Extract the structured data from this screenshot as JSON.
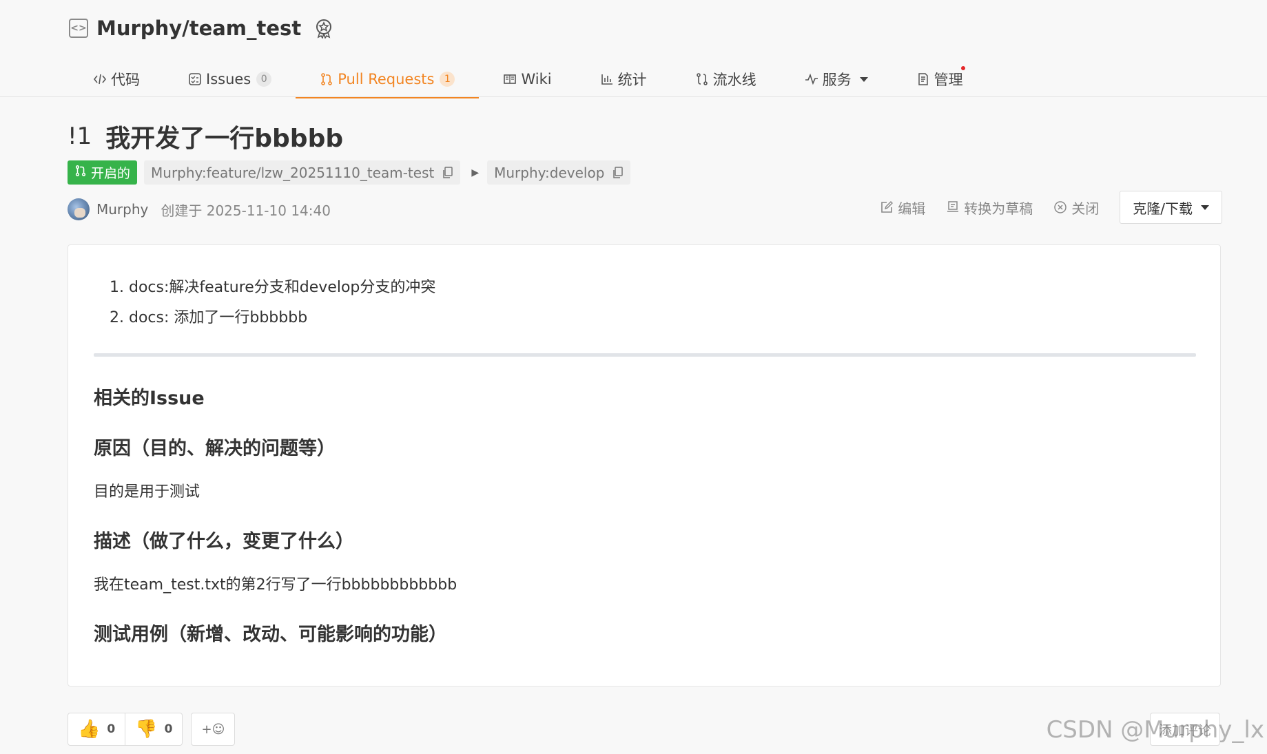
{
  "repo": {
    "title": "Murphy/team_test"
  },
  "tabs": [
    {
      "label": "代码",
      "icon": "code-icon"
    },
    {
      "label": "Issues",
      "icon": "issues-icon",
      "count": "0"
    },
    {
      "label": "Pull Requests",
      "icon": "pull-request-icon",
      "count": "1"
    },
    {
      "label": "Wiki",
      "icon": "book-icon"
    },
    {
      "label": "统计",
      "icon": "bar-chart-icon"
    },
    {
      "label": "流水线",
      "icon": "pipeline-icon"
    },
    {
      "label": "服务",
      "icon": "activity-icon"
    },
    {
      "label": "管理",
      "icon": "manage-icon"
    }
  ],
  "pr": {
    "number": "!1",
    "title": "我开发了一行bbbbb",
    "state": "开启的",
    "source_branch": "Murphy:feature/lzw_20251110_team-test",
    "target_branch": "Murphy:develop",
    "author": "Murphy",
    "created": "创建于 2025-11-10 14:40"
  },
  "actions": {
    "edit": "编辑",
    "draft": "转换为草稿",
    "close": "关闭",
    "clone": "克隆/下载"
  },
  "body": {
    "list": [
      "1. docs:解决feature分支和develop分支的冲突",
      "2. docs: 添加了一行bbbbbb"
    ],
    "h_issue": "相关的Issue",
    "h_reason": "原因（目的、解决的问题等）",
    "p_reason": "目的是用于测试",
    "h_desc": "描述（做了什么，变更了什么）",
    "p_desc": "我在team_test.txt的第2行写了一行bbbbbbbbbbbb",
    "h_test": "测试用例（新增、改动、可能影响的功能）"
  },
  "reactions": {
    "thumbs_up_count": "0",
    "thumbs_down_count": "0",
    "add_emoji": "+☺"
  },
  "comment": {
    "add_label": "添加评论"
  },
  "watermark": "CSDN @Murphy_lx",
  "colors": {
    "accent": "#f28522",
    "open_state": "#36b34a"
  }
}
